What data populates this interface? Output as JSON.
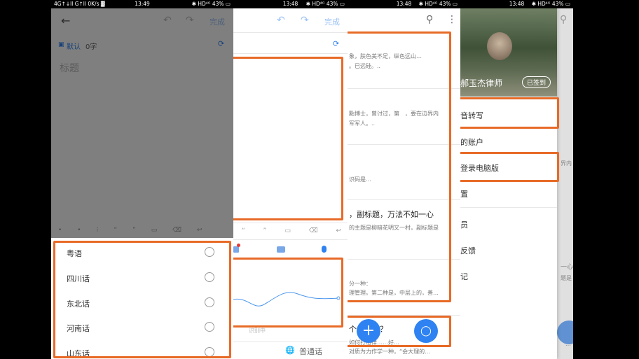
{
  "status": {
    "p1": {
      "left": "4G↑↓ll G↑ll 0K/s ▓",
      "time": "13:49",
      "right": "✱ HD⁴ᴳ 43% ▭"
    },
    "p2": {
      "time": "13:48",
      "right": "✱ HD⁴ᴳ 43% ▭"
    },
    "p3": {
      "time": "13:48",
      "right": "✱ HD⁴ᴳ 43% ▭"
    },
    "p4": {
      "time": "13:48",
      "right": "✱ HD⁴ᴳ 43% ▭"
    }
  },
  "editor": {
    "done": "完成",
    "notebook": "默认",
    "char_count": "0字",
    "title_placeholder": "标题",
    "dialects": [
      "粤语",
      "四川话",
      "东北话",
      "河南话",
      "山东话"
    ]
  },
  "voice": {
    "done": "完成",
    "language": "普通话",
    "hint": "识别中"
  },
  "notes": {
    "items": [
      {
        "line1": "象，肤色美不足，纵色远山…",
        "line2": "。已远硅。.."
      },
      {
        "line1": "點博士，曾讨过，第　，要在边界内",
        "line2": "军军人。.."
      },
      {
        "line1": "识码是…",
        "line2": ""
      },
      {
        "title": "，副标题，万法不如一心",
        "line1": "的主题是柳暗花明又一村，副标题是",
        "line2": ""
      },
      {
        "line1": "分一种：",
        "line2": "理管理。第二种是，中层上的，善…"
      },
      {
        "title": "个……力？",
        "line1": "如何打造律……好…",
        "line2": "对质为力作学一种，“会大理的…"
      }
    ]
  },
  "drawer": {
    "user_name": "郝玉杰律师",
    "signed_in": "已签到",
    "menu": [
      "音转写",
      "的账户",
      "登录电脑版",
      "置",
      "员",
      "反馈",
      "记"
    ],
    "side_text": [
      "界内",
      "一心",
      "题是",
      "…"
    ]
  }
}
